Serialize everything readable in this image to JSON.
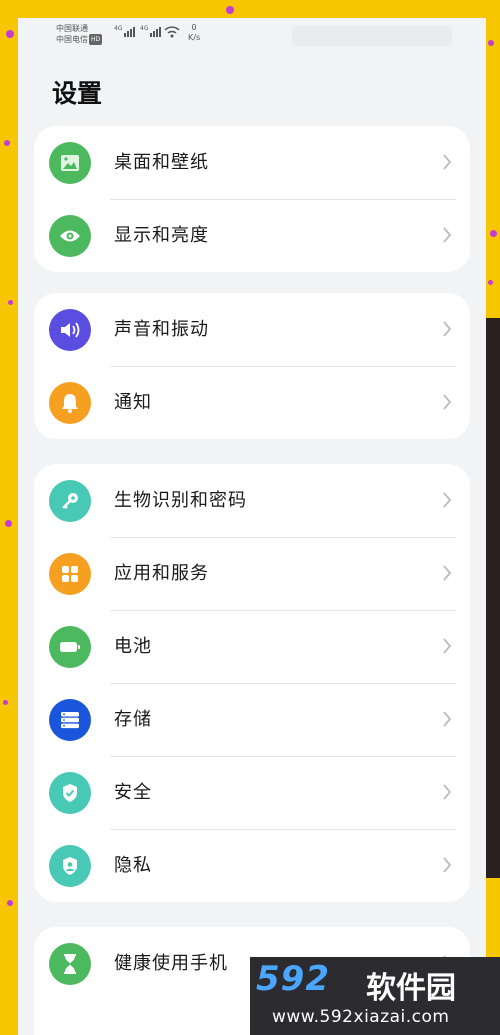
{
  "status_bar": {
    "carrier_1": "中国联通",
    "carrier_2": "中国电信",
    "hd_badge": "HD",
    "net_1": "4G",
    "net_2": "4G",
    "speed_value": "0",
    "speed_unit": "K/s"
  },
  "page_title": "设置",
  "groups": [
    {
      "items": [
        {
          "label": "桌面和壁纸",
          "icon": "wallpaper-icon",
          "color": "#4cb95e"
        },
        {
          "label": "显示和亮度",
          "icon": "eye-icon",
          "color": "#4cb95e"
        }
      ]
    },
    {
      "items": [
        {
          "label": "声音和振动",
          "icon": "speaker-icon",
          "color": "#5a4ee0"
        },
        {
          "label": "通知",
          "icon": "bell-icon",
          "color": "#f5a020"
        }
      ]
    },
    {
      "items": [
        {
          "label": "生物识别和密码",
          "icon": "key-icon",
          "color": "#47c9b5"
        },
        {
          "label": "应用和服务",
          "icon": "apps-grid-icon",
          "color": "#f5a020"
        },
        {
          "label": "电池",
          "icon": "battery-icon",
          "color": "#4cb95e"
        },
        {
          "label": "存储",
          "icon": "storage-icon",
          "color": "#1a56db"
        },
        {
          "label": "安全",
          "icon": "shield-check-icon",
          "color": "#47c9b5"
        },
        {
          "label": "隐私",
          "icon": "privacy-shield-icon",
          "color": "#47c9b5"
        }
      ]
    },
    {
      "items": [
        {
          "label": "健康使用手机",
          "icon": "hourglass-icon",
          "color": "#4cb95e"
        }
      ]
    }
  ],
  "watermark": {
    "logo": "592",
    "brand": "软件园",
    "url": "www.592xiazai.com"
  }
}
